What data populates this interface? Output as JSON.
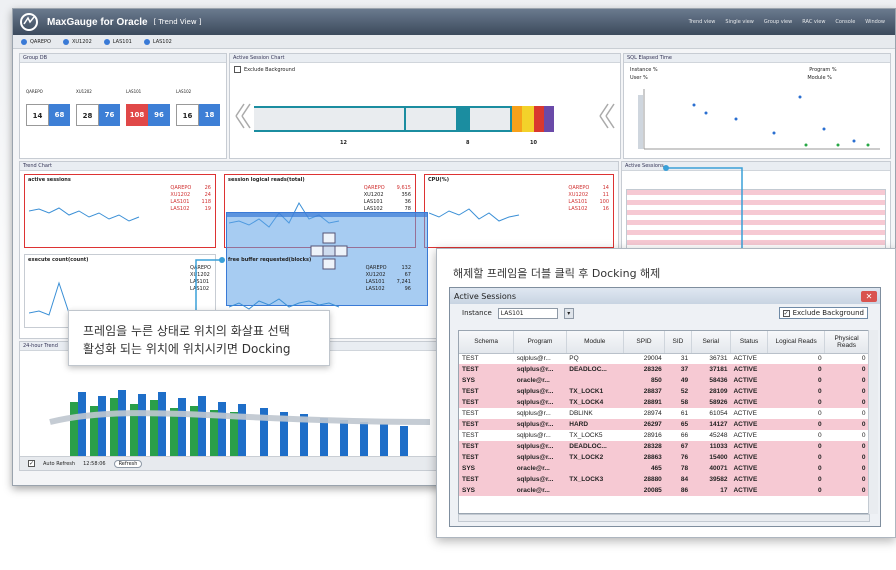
{
  "app": {
    "title": "MaxGauge for Oracle",
    "subtitle": "[ Trend View ]",
    "menu": [
      "Trend view",
      "Single view",
      "Group view",
      "RAC view",
      "Console",
      "Window"
    ]
  },
  "instances": [
    "QAREPO",
    "XU1202",
    "LAS101",
    "LAS102"
  ],
  "panels": {
    "group_db": "Group DB",
    "active_session_chart": "Active Session Chart",
    "exclude_background": "Exclude Background",
    "sql_elapsed": "SQL Elapsed Time",
    "trend_chart": "Trend Chart",
    "active_sessions_small": "Active Sessions",
    "trend_24h": "24-hour Trend"
  },
  "group_db_values": [
    {
      "name": "QAREPO",
      "a": "14",
      "b": "68"
    },
    {
      "name": "XU1202",
      "a": "28",
      "b": "76"
    },
    {
      "name": "LAS101",
      "a": "108",
      "b": "96"
    },
    {
      "name": "LAS102",
      "a": "16",
      "b": "18"
    }
  ],
  "active_session_numbers": [
    "12",
    "8",
    "10"
  ],
  "sql_filters": {
    "instance": "Instance %",
    "user": "User %",
    "program": "Program %",
    "module": "Module %"
  },
  "trend_mini": [
    {
      "title": "active sessions",
      "legend": [
        [
          "QAREPO",
          "26"
        ],
        [
          "XU1202",
          "24"
        ],
        [
          "LAS101",
          "118"
        ],
        [
          "LAS102",
          "19"
        ]
      ]
    },
    {
      "title": "session logical reads(total)",
      "legend": [
        [
          "QAREPO",
          "9,615"
        ],
        [
          "XU1202",
          "356"
        ],
        [
          "LAS101",
          "36"
        ],
        [
          "LAS102",
          "78"
        ]
      ]
    },
    {
      "title": "CPU(%)",
      "legend": [
        [
          "QAREPO",
          "14"
        ],
        [
          "XU1202",
          "11"
        ],
        [
          "LAS101",
          "100"
        ],
        [
          "LAS102",
          "16"
        ]
      ]
    },
    {
      "title": "execute count(count)",
      "legend": [
        [
          "QAREPO",
          ""
        ],
        [
          "XU1202",
          ""
        ],
        [
          "LAS101",
          ""
        ],
        [
          "LAS102",
          ""
        ]
      ]
    },
    {
      "title": "free buffer requested(blocks)",
      "legend": [
        [
          "QAREPO",
          "132"
        ],
        [
          "XU1202",
          "67"
        ],
        [
          "LAS101",
          "7,241"
        ],
        [
          "LAS102",
          "96"
        ]
      ]
    }
  ],
  "callout_drag": {
    "line1": "프레임을 누른 상태로 위치의 화살표 선택",
    "line2": "활성화 되는 위치에 위치시키면 Docking"
  },
  "callout_dock": "해제할 프레임을 더블 클릭 후 Docking 해제",
  "active_sessions": {
    "title": "Active Sessions",
    "instance_label": "Instance",
    "instance_value": "LAS101",
    "exclude_label": "Exclude Background",
    "columns": [
      "Schema",
      "Program",
      "Module",
      "SPID",
      "SID",
      "Serial",
      "Status",
      "Logical Reads",
      "Physical Reads"
    ],
    "rows": [
      {
        "style": "white",
        "cells": [
          "TEST",
          "sqlplus@r...",
          "PQ",
          "29004",
          "31",
          "36731",
          "ACTIVE",
          "0",
          "0"
        ]
      },
      {
        "style": "pink",
        "cells": [
          "TEST",
          "sqlplus@r...",
          "DEADLOC...",
          "28326",
          "37",
          "37181",
          "ACTIVE",
          "0",
          "0"
        ]
      },
      {
        "style": "pink",
        "cells": [
          "SYS",
          "oracle@r...",
          "",
          "850",
          "49",
          "58436",
          "ACTIVE",
          "0",
          "0"
        ]
      },
      {
        "style": "pink",
        "cells": [
          "TEST",
          "sqlplus@r...",
          "TX_LOCK1",
          "28837",
          "52",
          "28109",
          "ACTIVE",
          "0",
          "0"
        ]
      },
      {
        "style": "pink",
        "cells": [
          "TEST",
          "sqlplus@r...",
          "TX_LOCK4",
          "28891",
          "58",
          "58926",
          "ACTIVE",
          "0",
          "0"
        ]
      },
      {
        "style": "white",
        "cells": [
          "TEST",
          "sqlplus@r...",
          "DBLINK",
          "28974",
          "61",
          "61054",
          "ACTIVE",
          "0",
          "0"
        ]
      },
      {
        "style": "pink",
        "cells": [
          "TEST",
          "sqlplus@r...",
          "HARD",
          "26297",
          "65",
          "14127",
          "ACTIVE",
          "0",
          "0"
        ]
      },
      {
        "style": "white",
        "cells": [
          "TEST",
          "sqlplus@r...",
          "TX_LOCK5",
          "28916",
          "66",
          "45248",
          "ACTIVE",
          "0",
          "0"
        ]
      },
      {
        "style": "pink",
        "cells": [
          "TEST",
          "sqlplus@r...",
          "DEADLOC...",
          "28328",
          "67",
          "11033",
          "ACTIVE",
          "0",
          "0"
        ]
      },
      {
        "style": "pink",
        "cells": [
          "TEST",
          "sqlplus@r...",
          "TX_LOCK2",
          "28863",
          "76",
          "15400",
          "ACTIVE",
          "0",
          "0"
        ]
      },
      {
        "style": "pink",
        "cells": [
          "SYS",
          "oracle@r...",
          "",
          "465",
          "78",
          "40071",
          "ACTIVE",
          "0",
          "0"
        ]
      },
      {
        "style": "pink",
        "cells": [
          "TEST",
          "sqlplus@r...",
          "TX_LOCK3",
          "28880",
          "84",
          "39582",
          "ACTIVE",
          "0",
          "0"
        ]
      },
      {
        "style": "pink",
        "cells": [
          "SYS",
          "oracle@r...",
          "",
          "20085",
          "86",
          "17",
          "ACTIVE",
          "0",
          "0"
        ]
      }
    ]
  },
  "bottom_bar": {
    "autorefresh": "Auto Refresh",
    "time": "12:58:06",
    "refresh": "Refresh"
  },
  "colors": {
    "accent": "#3a7ad6",
    "alert": "#d03030",
    "pink_row": "#f6c9d3",
    "dock_overlay": "#5fa2e8"
  }
}
